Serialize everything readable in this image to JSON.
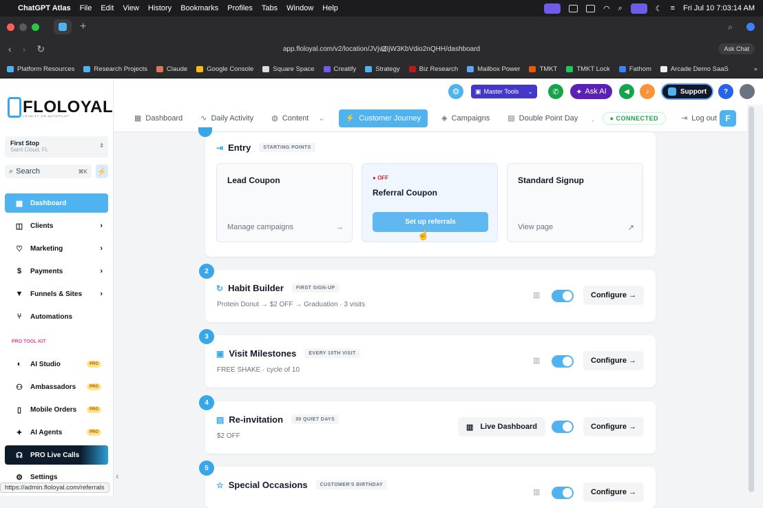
{
  "menubar": {
    "app": "ChatGPT Atlas",
    "items": [
      "File",
      "Edit",
      "View",
      "History",
      "Bookmarks",
      "Profiles",
      "Tabs",
      "Window",
      "Help"
    ],
    "clock": "Fri Jul 10  7:03:14 AM"
  },
  "browser": {
    "url": "app.floloyal.com/v2/location/JVjvZIjW3KbVdio2nQHH/dashboard",
    "ask_chat": "Ask Chat"
  },
  "bookmarks": [
    {
      "label": "Platform Resources",
      "color": "#4fb3f0"
    },
    {
      "label": "Research Projects",
      "color": "#4fb3f0"
    },
    {
      "label": "Claude",
      "color": "#d97757"
    },
    {
      "label": "Google Console",
      "color": "#fbbc04"
    },
    {
      "label": "Square Space",
      "color": "#dddddd"
    },
    {
      "label": "Creatify",
      "color": "#6d5ce7"
    },
    {
      "label": "Strategy",
      "color": "#4fb3f0"
    },
    {
      "label": "Biz Research",
      "color": "#b91c1c"
    },
    {
      "label": "Mailbox Power",
      "color": "#60a5fa"
    },
    {
      "label": "TMKT",
      "color": "#ea580c"
    },
    {
      "label": "TMKT Lock",
      "color": "#22c55e"
    },
    {
      "label": "Fathom",
      "color": "#3b82f6"
    },
    {
      "label": "Arcade Demo SaaS",
      "color": "#eeeeee"
    }
  ],
  "sidebar": {
    "logo": "FLOLOYAL",
    "logo_sub": "LOYALTY ON AUTOPILOT",
    "location_name": "First Stop",
    "location_city": "Saint Cloud, FL",
    "search_placeholder": "Search",
    "search_kbd": "⌘K",
    "items": [
      {
        "label": "Dashboard",
        "icon": "grid-icon"
      },
      {
        "label": "Clients",
        "icon": "user-icon"
      },
      {
        "label": "Marketing",
        "icon": "heart-icon"
      },
      {
        "label": "Payments",
        "icon": "dollar-icon"
      },
      {
        "label": "Funnels & Sites",
        "icon": "funnel-icon"
      },
      {
        "label": "Automations",
        "icon": "branch-icon"
      }
    ],
    "pro_kit_label": "PRO TOOL KIT",
    "pro_items": [
      {
        "label": "AI Studio",
        "badge": "PRO"
      },
      {
        "label": "Ambassadors",
        "badge": "PRO"
      },
      {
        "label": "Mobile Orders",
        "badge": "PRO"
      },
      {
        "label": "AI Agents",
        "badge": "PRO"
      },
      {
        "label": "PRO Live Calls"
      }
    ],
    "settings": "Settings"
  },
  "topbar": {
    "master_tools": "Master Tools",
    "ask_ai": "Ask AI",
    "support": "Support",
    "help": "?"
  },
  "tabs": {
    "items": [
      "Dashboard",
      "Daily Activity",
      "Content",
      "Customer Journey",
      "Campaigns",
      "Double Point Day"
    ],
    "active": "Customer Journey",
    "connected": "CONNECTED",
    "logout": "Log out"
  },
  "entry": {
    "title": "Entry",
    "tag": "STARTING POINTS",
    "cards": [
      {
        "title": "Lead Coupon",
        "link": "Manage campaigns"
      },
      {
        "status": "OFF",
        "title": "Referral Coupon",
        "button": "Set up referrals"
      },
      {
        "title": "Standard Signup",
        "link": "View page"
      }
    ]
  },
  "steps": [
    {
      "num": "2",
      "title": "Habit Builder",
      "tag": "FIRST SIGN-UP",
      "sub": "Protein Donut → $2 OFF → Graduation · 3 visits",
      "enabled": true,
      "configure": "Configure →"
    },
    {
      "num": "3",
      "title": "Visit Milestones",
      "tag": "EVERY 10TH VISIT",
      "sub": "FREE SHAKE · cycle of 10",
      "enabled": true,
      "configure": "Configure →"
    },
    {
      "num": "4",
      "title": "Re-invitation",
      "tag": "30 QUIET DAYS",
      "sub": "$2 OFF",
      "enabled": true,
      "configure": "Configure →",
      "extra": "Live Dashboard"
    },
    {
      "num": "5",
      "title": "Special Occasions",
      "tag": "CUSTOMER'S BIRTHDAY",
      "enabled": true,
      "configure": "Configure →"
    }
  ],
  "status_bar_url": "https://admin.floloyal.com/referrals"
}
